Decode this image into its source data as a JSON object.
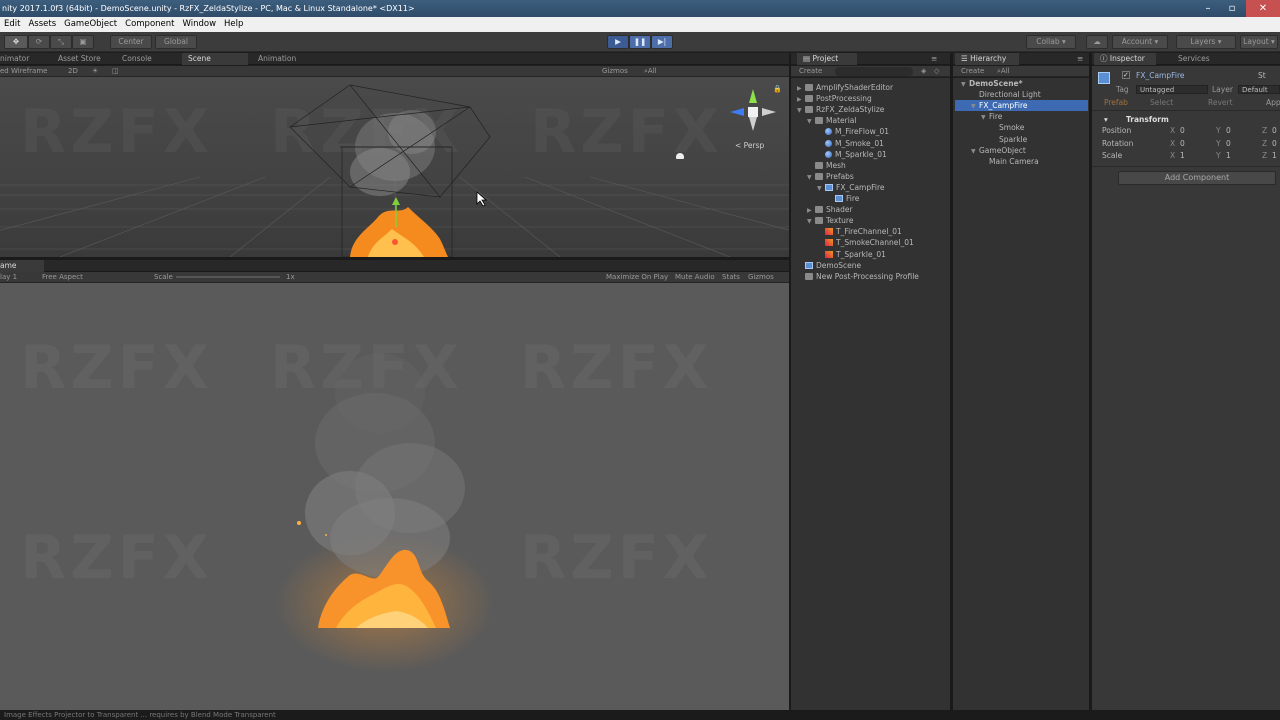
{
  "window": {
    "title": "nity 2017.1.0f3 (64bit) - DemoScene.unity - RzFX_ZeldaStylize - PC, Mac & Linux Standalone* <DX11>"
  },
  "menu": [
    "Edit",
    "Assets",
    "GameObject",
    "Component",
    "Window",
    "Help"
  ],
  "toolbar": {
    "pivot": "Center",
    "space": "Global",
    "collab": "Collab",
    "account": "Account",
    "layers": "Layers",
    "layout": "Layout"
  },
  "left_tabs": {
    "animator": "nimator",
    "asset_store": "Asset Store",
    "console": "Console",
    "scene": "Scene",
    "animation": "Animation"
  },
  "scene": {
    "shading": "ed Wireframe",
    "mode2d": "2D",
    "gizmos": "Gizmos",
    "search": "All",
    "persp": "Persp",
    "watermark": "RZFX"
  },
  "game": {
    "tab": "ame",
    "display": "lay 1",
    "aspect": "Free Aspect",
    "scale_label": "Scale",
    "scale_value": "1x",
    "maximize": "Maximize On Play",
    "mute": "Mute Audio",
    "stats": "Stats",
    "gizmos": "Gizmos"
  },
  "project": {
    "tab": "Project",
    "create": "Create",
    "items": [
      {
        "label": "AmplifyShaderEditor",
        "indent": 0,
        "icon": "folder-icon",
        "arrow": "▶"
      },
      {
        "label": "PostProcessing",
        "indent": 0,
        "icon": "folder-icon",
        "arrow": "▶"
      },
      {
        "label": "RzFX_ZeldaStylize",
        "indent": 0,
        "icon": "folder-icon",
        "arrow": "▼"
      },
      {
        "label": "Material",
        "indent": 1,
        "icon": "folder-icon",
        "arrow": "▼"
      },
      {
        "label": "M_FireFlow_01",
        "indent": 2,
        "icon": "material-icon",
        "arrow": ""
      },
      {
        "label": "M_Smoke_01",
        "indent": 2,
        "icon": "material-icon",
        "arrow": ""
      },
      {
        "label": "M_Sparkle_01",
        "indent": 2,
        "icon": "material-icon",
        "arrow": ""
      },
      {
        "label": "Mesh",
        "indent": 1,
        "icon": "folder-icon",
        "arrow": ""
      },
      {
        "label": "Prefabs",
        "indent": 1,
        "icon": "folder-icon",
        "arrow": "▼"
      },
      {
        "label": "FX_CampFire",
        "indent": 2,
        "icon": "prefab-icon",
        "arrow": "▼"
      },
      {
        "label": "Fire",
        "indent": 3,
        "icon": "prefab-icon",
        "arrow": ""
      },
      {
        "label": "Shader",
        "indent": 1,
        "icon": "folder-icon",
        "arrow": "▶"
      },
      {
        "label": "Texture",
        "indent": 1,
        "icon": "folder-icon",
        "arrow": "▼"
      },
      {
        "label": "T_FireChannel_01",
        "indent": 2,
        "icon": "texture-icon",
        "arrow": ""
      },
      {
        "label": "T_SmokeChannel_01",
        "indent": 2,
        "icon": "texture-icon",
        "arrow": ""
      },
      {
        "label": "T_Sparkle_01",
        "indent": 2,
        "icon": "texture-icon",
        "arrow": ""
      },
      {
        "label": "DemoScene",
        "indent": 0,
        "icon": "unity-scene-icon",
        "arrow": ""
      },
      {
        "label": "New Post-Processing Profile",
        "indent": 0,
        "icon": "profile-icon",
        "arrow": ""
      }
    ]
  },
  "hierarchy": {
    "tab": "Hierarchy",
    "create": "Create",
    "search": "All",
    "items": [
      {
        "label": "DemoScene*",
        "indent": 0,
        "arrow": "▼"
      },
      {
        "label": "Directional Light",
        "indent": 1,
        "arrow": ""
      },
      {
        "label": "FX_CampFire",
        "indent": 1,
        "arrow": "▼"
      },
      {
        "label": "Fire",
        "indent": 2,
        "arrow": "▼"
      },
      {
        "label": "Smoke",
        "indent": 3,
        "arrow": ""
      },
      {
        "label": "Sparkle",
        "indent": 3,
        "arrow": ""
      },
      {
        "label": "GameObject",
        "indent": 1,
        "arrow": "▼"
      },
      {
        "label": "Main Camera",
        "indent": 2,
        "arrow": ""
      }
    ]
  },
  "inspector": {
    "tab": "Inspector",
    "services": "Services",
    "object_name": "FX_CampFire",
    "static": "St",
    "tag_label": "Tag",
    "tag_value": "Untagged",
    "layer_label": "Layer",
    "layer_value": "Default",
    "prefab": "Prefab",
    "select": "Select",
    "revert": "Revert",
    "apply": "App",
    "transform": "Transform",
    "rows": [
      {
        "label": "Position",
        "x": "0",
        "y": "0",
        "z": "0"
      },
      {
        "label": "Rotation",
        "x": "0",
        "y": "0",
        "z": "0"
      },
      {
        "label": "Scale",
        "x": "1",
        "y": "1",
        "z": "1"
      }
    ],
    "axis_x": "X",
    "axis_y": "Y",
    "axis_z": "Z",
    "add_component": "Add Component"
  },
  "status": "Image Effects Projector to Transparent ... requires by Blend Mode Transparent"
}
